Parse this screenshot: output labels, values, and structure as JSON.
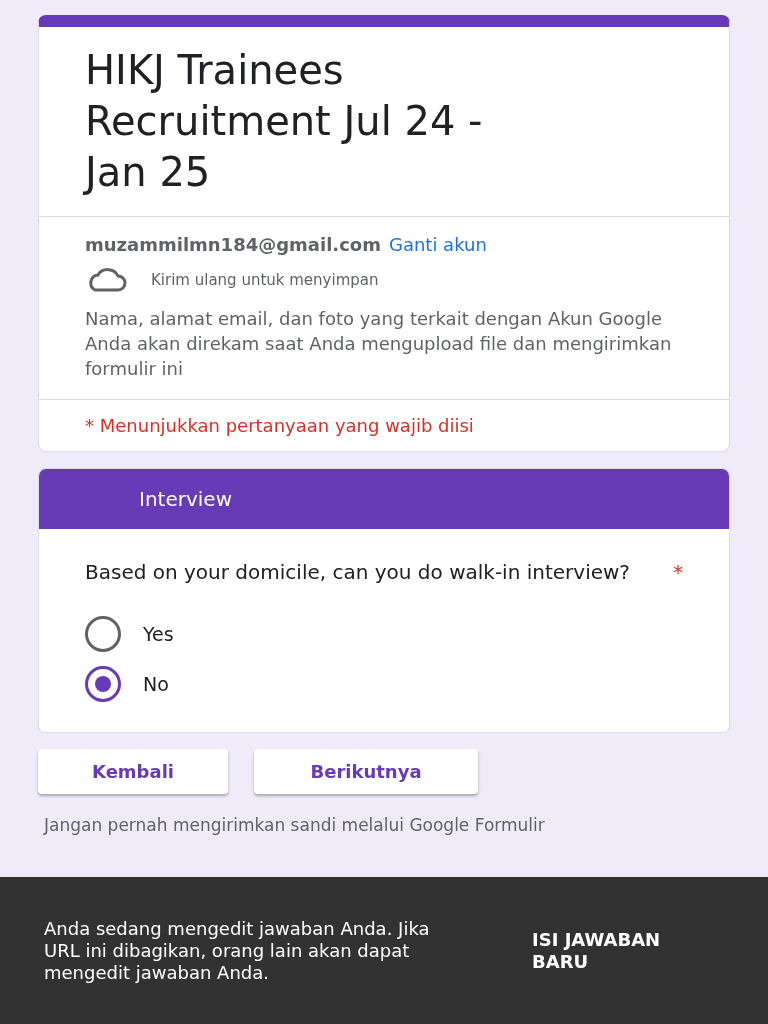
{
  "form": {
    "title": "HIKJ Trainees Recruitment Jul 24 - Jan 25",
    "account": {
      "email": "muzammilmn184@gmail.com",
      "switch_link": "Ganti akun"
    },
    "save_status": "Kirim ulang untuk menyimpan",
    "privacy_notice": "Nama, alamat email, dan foto yang terkait dengan Akun Google Anda akan direkam saat Anda mengupload file dan mengirimkan formulir ini",
    "required_notice": "* Menunjukkan pertanyaan yang wajib diisi"
  },
  "section": {
    "title": "Interview",
    "question": {
      "text": "Based on your domicile, can you do walk-in interview?",
      "required_mark": "*",
      "options": [
        {
          "label": "Yes",
          "selected": false
        },
        {
          "label": "No",
          "selected": true
        }
      ]
    }
  },
  "buttons": [
    "Kembali",
    "Berikutnya"
  ],
  "footer_note": "Jangan pernah mengirimkan sandi melalui Google Formulir",
  "snackbar": {
    "message": "Anda sedang mengedit jawaban Anda. Jika URL ini dibagikan, orang lain akan dapat mengedit jawaban Anda.",
    "action": "ISI JAWABAN BARU"
  }
}
